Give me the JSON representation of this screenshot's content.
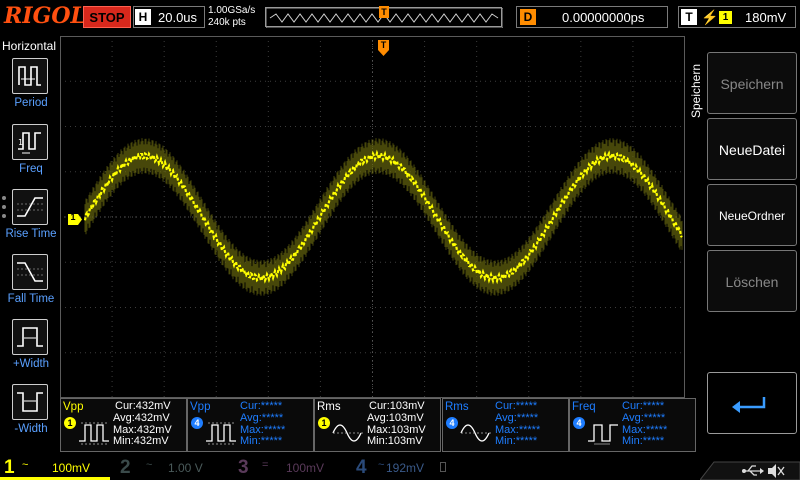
{
  "brand": "RIGOL",
  "run_state": "STOP",
  "timebase": {
    "letter": "H",
    "value": "20.0us",
    "sample_rate": "1.00GSa/s",
    "points": "240k pts"
  },
  "trigger_marker": "T",
  "delay": {
    "letter": "D",
    "value": "0.00000000ps"
  },
  "trigger": {
    "letter": "T",
    "source": "1",
    "level": "180mV"
  },
  "left_menu": {
    "title": "Horizontal",
    "items": [
      {
        "label": "Period"
      },
      {
        "label": "Freq"
      },
      {
        "label": "Rise Time"
      },
      {
        "label": "Fall Time"
      },
      {
        "label": "+Width"
      },
      {
        "label": "-Width"
      }
    ]
  },
  "right_menu": {
    "title": "Speichern",
    "buttons": [
      {
        "label": "Speichern"
      },
      {
        "label": "NeueDatei"
      },
      {
        "label": "NeueOrdner"
      },
      {
        "label": "Löschen"
      }
    ]
  },
  "channel_marker": "1",
  "measurements": [
    {
      "name": "Vpp",
      "channel": "1",
      "cur": "Cur:432mV",
      "avg": "Avg:432mV",
      "max": "Max:432mV",
      "min": "Min:432mV"
    },
    {
      "name": "Vpp",
      "channel": "4",
      "cur": "Cur:*****",
      "avg": "Avg:*****",
      "max": "Max:*****",
      "min": "Min:*****"
    },
    {
      "name": "Rms",
      "channel": "1",
      "cur": "Cur:103mV",
      "avg": "Avg:103mV",
      "max": "Max:103mV",
      "min": "Min:103mV"
    },
    {
      "name": "Rms",
      "channel": "4",
      "cur": "Cur:*****",
      "avg": "Avg:*****",
      "max": "Max:*****",
      "min": "Min:*****"
    },
    {
      "name": "Freq",
      "channel": "4",
      "cur": "Cur:*****",
      "avg": "Avg:*****",
      "max": "Max:*****",
      "min": "Min:*****"
    }
  ],
  "channels": [
    {
      "num": "1",
      "coupling": "~",
      "scale": "100mV",
      "color": "#ffff00"
    },
    {
      "num": "2",
      "coupling": "~",
      "scale": "1.00 V",
      "color": "#3a4a4a"
    },
    {
      "num": "3",
      "coupling": "=",
      "scale": "100mV",
      "color": "#4a2a4a"
    },
    {
      "num": "4",
      "coupling": "~",
      "scale": "192mV",
      "color": "#2a3a5a"
    }
  ],
  "colors": {
    "ch1": "#ffff00",
    "ch4": "#1e7dff",
    "accent": "#ff8c00",
    "label_blue": "#5aa0ff",
    "stop": "#d8281c"
  },
  "icons": {
    "usb": "usb-icon",
    "sound": "speaker-muted-icon",
    "enter": "enter-arrow-icon"
  }
}
